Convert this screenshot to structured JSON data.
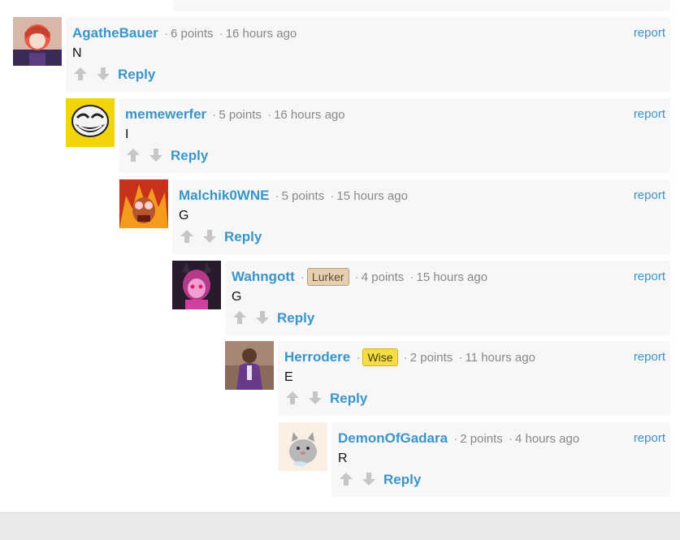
{
  "comments": [
    {
      "username": "AgatheBauer",
      "badge": "",
      "points": "6 points",
      "time": "16 hours ago",
      "text": "N",
      "report": "report",
      "reply": "Reply",
      "avatar": "red-haired-anime-avatar"
    },
    {
      "username": "memewerfer",
      "badge": "",
      "points": "5 points",
      "time": "16 hours ago",
      "text": "I",
      "report": "report",
      "reply": "Reply",
      "avatar": "trollface-avatar"
    },
    {
      "username": "Malchik0WNE",
      "badge": "",
      "points": "5 points",
      "time": "15 hours ago",
      "text": "G",
      "report": "report",
      "reply": "Reply",
      "avatar": "flaming-cartoon-avatar"
    },
    {
      "username": "Wahngott",
      "badge": "Lurker",
      "points": "4 points",
      "time": "15 hours ago",
      "text": "G",
      "report": "report",
      "reply": "Reply",
      "avatar": "pink-demon-girl-avatar"
    },
    {
      "username": "Herrodere",
      "badge": "Wise",
      "points": "2 points",
      "time": "11 hours ago",
      "text": "E",
      "report": "report",
      "reply": "Reply",
      "avatar": "man-purple-suit-avatar"
    },
    {
      "username": "DemonOfGadara",
      "badge": "",
      "points": "2 points",
      "time": "4 hours ago",
      "text": "R",
      "report": "report",
      "reply": "Reply",
      "avatar": "gray-cat-avatar"
    }
  ],
  "colors": {
    "link": "#3a95c9",
    "box": "#f7f7f7",
    "lurker_badge": "#e6cfae",
    "wise_badge": "#f5de45"
  }
}
